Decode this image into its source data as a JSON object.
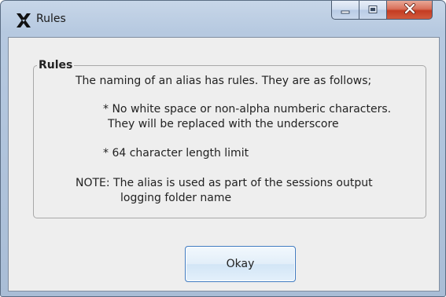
{
  "window": {
    "title": "Rules",
    "controls": [
      "minimize-icon",
      "maximize-icon",
      "close-icon"
    ]
  },
  "group": {
    "legend": "Rules",
    "intro": "The naming of an alias has rules. They are as follows;",
    "rule1_line1": "* No white space or non-alpha numberic characters.",
    "rule1_line2": "They will be replaced with the underscore",
    "rule2": "* 64 character length limit",
    "note_line1": "NOTE: The alias is used as part of the sessions output",
    "note_line2": "logging folder name"
  },
  "buttons": {
    "okay": "Okay"
  },
  "colors": {
    "close_button": "#c43c22",
    "okay_border": "#3f7bc1",
    "client_bg": "#eeeeee"
  }
}
